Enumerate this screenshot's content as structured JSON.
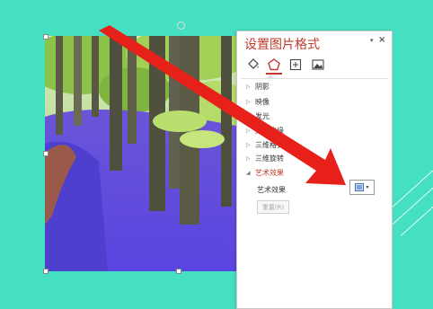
{
  "pane": {
    "title": "设置图片格式",
    "menu_glyph": "▾",
    "close_glyph": "×",
    "tabs": [
      {
        "name": "fill-line",
        "icon": "paint-bucket-icon"
      },
      {
        "name": "effects",
        "icon": "pentagon-icon",
        "active": true
      },
      {
        "name": "size-properties",
        "icon": "size-icon"
      },
      {
        "name": "picture",
        "icon": "picture-icon"
      }
    ],
    "sections": [
      {
        "label": "阴影",
        "expanded": false
      },
      {
        "label": "映像",
        "expanded": false
      },
      {
        "label": "发光",
        "expanded": false
      },
      {
        "label": "柔化边缘",
        "expanded": false
      },
      {
        "label": "三维格式",
        "expanded": false
      },
      {
        "label": "三维旋转",
        "expanded": false
      },
      {
        "label": "艺术效果",
        "expanded": true
      }
    ],
    "collapsed_glyph": "▷",
    "expanded_glyph": "◢",
    "artistic": {
      "field_label": "艺术效果",
      "reset_label": "重置(R)"
    }
  },
  "colors": {
    "background": "#45e0c2",
    "accent": "#c0392b",
    "arrow": "#e8201a"
  }
}
